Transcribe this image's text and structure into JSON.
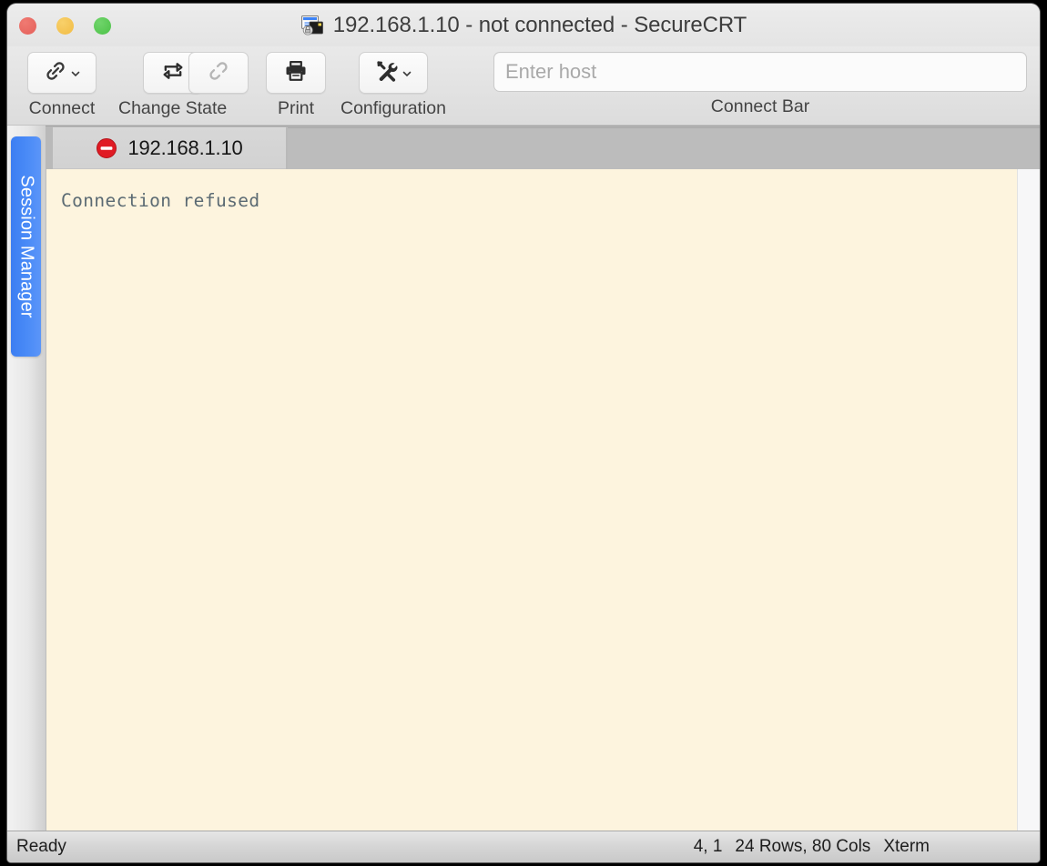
{
  "window": {
    "title": "192.168.1.10 - not connected - SecureCRT",
    "app_icon": "securecrt-terminal-lock-icon",
    "traffic_lights": {
      "close": "close-button",
      "minimize": "minimize-button",
      "maximize": "maximize-button"
    },
    "colors": {
      "titlebar_bg": "#ececec",
      "toolbar_bg": "#e2e2e2",
      "tabbar_bg": "#b9b9b9",
      "active_tab_bg": "#d4d4d4",
      "terminal_bg": "#fdf4de",
      "terminal_fg": "#5b6a73",
      "session_manager_blue": "#4a8bf7",
      "status_red": "#e01b24",
      "statusbar_bg": "#d5d5d5",
      "traffic_red": "#e4605a",
      "traffic_yellow": "#f2bc44",
      "traffic_green": "#4cc247"
    }
  },
  "toolbar": {
    "items": [
      {
        "id": "connect",
        "label": "Connect",
        "icon": "chain-link-icon",
        "has_chevron": true,
        "enabled": true
      },
      {
        "id": "change-state",
        "label": "Change State",
        "icon": "repeat-loop-icon",
        "has_chevron": false,
        "enabled": true
      },
      {
        "id": "disconnect",
        "label": "",
        "icon": "broken-chain-link-icon",
        "has_chevron": false,
        "enabled": false
      },
      {
        "id": "print",
        "label": "Print",
        "icon": "printer-icon",
        "has_chevron": false,
        "enabled": true
      },
      {
        "id": "configuration",
        "label": "Configuration",
        "icon": "tools-wrench-screwdriver-icon",
        "has_chevron": true,
        "enabled": true
      }
    ]
  },
  "connect_bar": {
    "label": "Connect Bar",
    "placeholder": "Enter host",
    "value": ""
  },
  "sidebar": {
    "session_manager": {
      "label": "Session Manager",
      "active": true
    }
  },
  "tabs": [
    {
      "label": "192.168.1.10",
      "status_icon": "no-entry-prohibition-icon",
      "active": true
    }
  ],
  "terminal": {
    "lines": [
      "Connection refused"
    ],
    "rows": 24,
    "cols": 80
  },
  "statusbar": {
    "status": "Ready",
    "cursor_position": "4, 1",
    "dimensions": "24 Rows, 80 Cols",
    "emulation": "Xterm"
  }
}
